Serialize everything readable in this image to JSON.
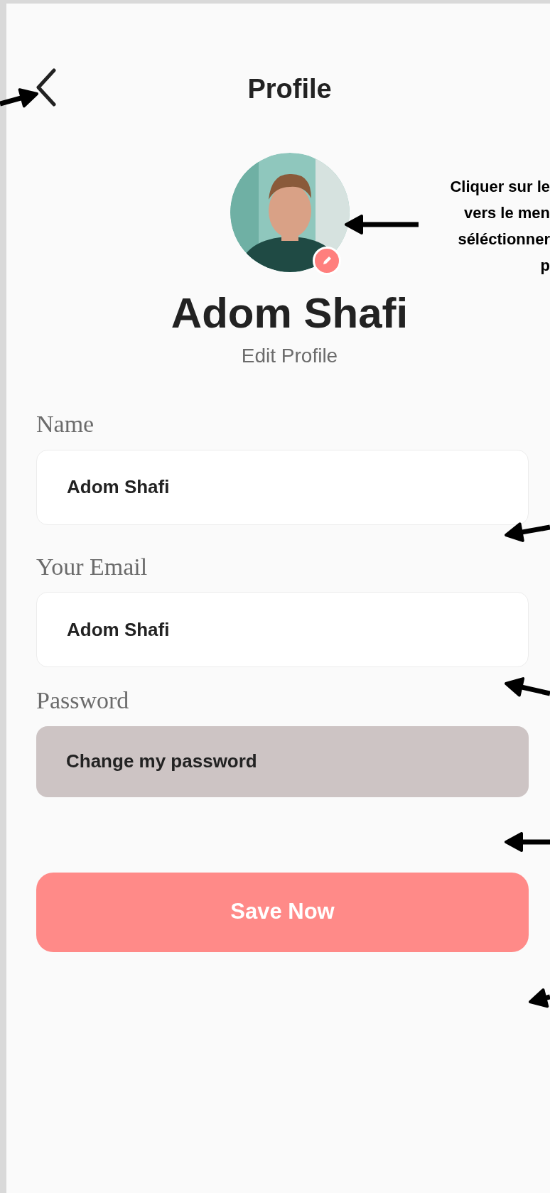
{
  "header": {
    "title": "Profile"
  },
  "profile": {
    "name": "Adom Shafi",
    "subtitle": "Edit Profile"
  },
  "fields": [
    {
      "label": "Name",
      "value": "Adom Shafi",
      "kind": "input"
    },
    {
      "label": "Your Email",
      "value": "Adom Shafi",
      "kind": "input"
    },
    {
      "label": "Password",
      "value": "Change my password",
      "kind": "action"
    }
  ],
  "save_button": {
    "label": "Save Now"
  },
  "annotation": {
    "lines": [
      "Cliquer sur le",
      "vers le men",
      "séléctionner",
      "p"
    ]
  }
}
